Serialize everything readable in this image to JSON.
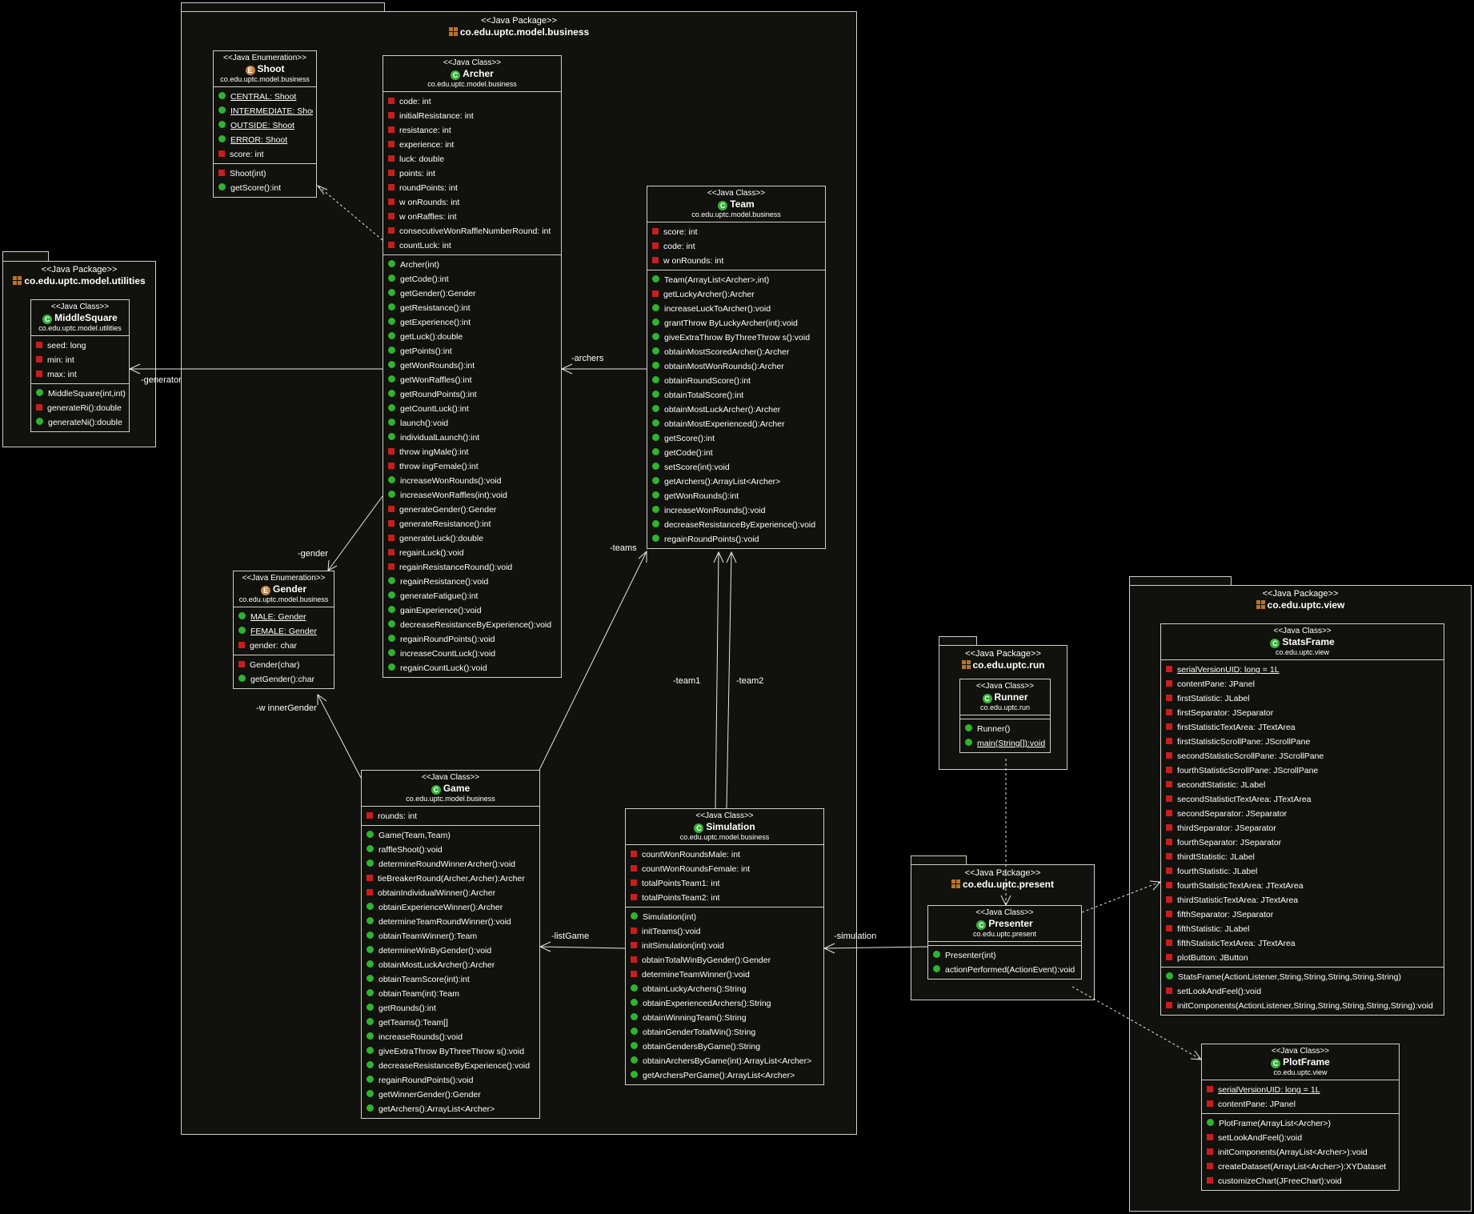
{
  "packages": {
    "business": {
      "stereotype": "<<Java Package>>",
      "name": "co.edu.uptc.model.business"
    },
    "utilities": {
      "stereotype": "<<Java Package>>",
      "name": "co.edu.uptc.model.utilities"
    },
    "view": {
      "stereotype": "<<Java Package>>",
      "name": "co.edu.uptc.view"
    },
    "run": {
      "stereotype": "<<Java Package>>",
      "name": "co.edu.uptc.run"
    },
    "present": {
      "stereotype": "<<Java Package>>",
      "name": "co.edu.uptc.present"
    }
  },
  "classes": {
    "shoot": {
      "stereotype": "<<Java Enumeration>>",
      "name": "Shoot",
      "package": "co.edu.uptc.model.business",
      "attributes": [
        "CENTRAL: Shoot",
        "INTERMEDIATE: Shoot",
        "OUTSIDE: Shoot",
        "ERROR: Shoot",
        "score: int"
      ],
      "operations": [
        "Shoot(int)",
        "getScore():int"
      ]
    },
    "archer": {
      "stereotype": "<<Java Class>>",
      "name": "Archer",
      "package": "co.edu.uptc.model.business",
      "attributes": [
        "code: int",
        "initialResistance: int",
        "resistance: int",
        "experience: int",
        "luck: double",
        "points: int",
        "roundPoints: int",
        "w onRounds: int",
        "w onRaffles: int",
        "consecutiveWonRaffleNumberRound: int",
        "countLuck: int"
      ],
      "operations": [
        "Archer(int)",
        "getCode():int",
        "getGender():Gender",
        "getResistance():int",
        "getExperience():int",
        "getLuck():double",
        "getPoints():int",
        "getWonRounds():int",
        "getWonRaffles():int",
        "getRoundPoints():int",
        "getCountLuck():int",
        "launch():void",
        "individualLaunch():int",
        "throw ingMale():int",
        "throw ingFemale():int",
        "increaseWonRounds():void",
        "increaseWonRaffles(int):void",
        "generateGender():Gender",
        "generateResistance():int",
        "generateLuck():double",
        "regainLuck():void",
        "regainResistanceRound():void",
        "regainResistance():void",
        "generateFatigue():int",
        "gainExperience():void",
        "decreaseResistanceByExperience():void",
        "regainRoundPoints():void",
        "increaseCountLuck():void",
        "regainCountLuck():void"
      ]
    },
    "team": {
      "stereotype": "<<Java Class>>",
      "name": "Team",
      "package": "co.edu.uptc.model.business",
      "attributes": [
        "score: int",
        "code: int",
        "w onRounds: int"
      ],
      "operations": [
        "Team(ArrayList<Archer>,int)",
        "getLuckyArcher():Archer",
        "increaseLuckToArcher():void",
        "grantThrow ByLuckyArcher(int):void",
        "giveExtraThrow ByThreeThrow s():void",
        "obtainMostScoredArcher():Archer",
        "obtainMostWonRounds():Archer",
        "obtainRoundScore():int",
        "obtainTotalScore():int",
        "obtainMostLuckArcher():Archer",
        "obtainMostExperienced():Archer",
        "getScore():int",
        "getCode():int",
        "setScore(int):void",
        "getArchers():ArrayList<Archer>",
        "getWonRounds():int",
        "increaseWonRounds():void",
        "decreaseResistanceByExperience():void",
        "regainRoundPoints():void"
      ]
    },
    "middlesquare": {
      "stereotype": "<<Java Class>>",
      "name": "MiddleSquare",
      "package": "co.edu.uptc.model.utilities",
      "attributes": [
        "seed: long",
        "min: int",
        "max: int"
      ],
      "operations": [
        "MiddleSquare(int,int)",
        "generateRi():double",
        "generateNi():double"
      ]
    },
    "gender": {
      "stereotype": "<<Java Enumeration>>",
      "name": "Gender",
      "package": "co.edu.uptc.model.business",
      "attributes": [
        "MALE: Gender",
        "FEMALE: Gender",
        "gender: char"
      ],
      "operations": [
        "Gender(char)",
        "getGender():char"
      ]
    },
    "game": {
      "stereotype": "<<Java Class>>",
      "name": "Game",
      "package": "co.edu.uptc.model.business",
      "attributes": [
        "rounds: int"
      ],
      "operations": [
        "Game(Team,Team)",
        "raffleShoot():void",
        "determineRoundWinnerArcher():void",
        "tieBreakerRound(Archer,Archer):Archer",
        "obtainIndividualWinner():Archer",
        "obtainExperienceWinner():Archer",
        "determineTeamRoundWinner():void",
        "obtainTeamWinner():Team",
        "determineWinByGender():void",
        "obtainMostLuckArcher():Archer",
        "obtainTeamScore(int):int",
        "obtainTeam(int):Team",
        "getRounds():int",
        "getTeams():Team[]",
        "increaseRounds():void",
        "giveExtraThrow ByThreeThrow s():void",
        "decreaseResistanceByExperience():void",
        "regainRoundPoints():void",
        "getWinnerGender():Gender",
        "getArchers():ArrayList<Archer>"
      ]
    },
    "simulation": {
      "stereotype": "<<Java Class>>",
      "name": "Simulation",
      "package": "co.edu.uptc.model.business",
      "attributes": [
        "countWonRoundsMale: int",
        "countWonRoundsFemale: int",
        "totalPointsTeam1: int",
        "totalPointsTeam2: int"
      ],
      "operations": [
        "Simulation(int)",
        "initTeams():void",
        "initSimulation(int):void",
        "obtainTotalWinByGender():Gender",
        "determineTeamWinner():void",
        "obtainLuckyArchers():String",
        "obtainExperiencedArchers():String",
        "obtainWinningTeam():String",
        "obtainGenderTotalWin():String",
        "obtainGendersByGame():String",
        "obtainArchersByGame(int):ArrayList<Archer>",
        "getArchersPerGame():ArrayList<Archer>"
      ]
    },
    "runner": {
      "stereotype": "<<Java Class>>",
      "name": "Runner",
      "package": "co.edu.uptc.run",
      "attributes": [],
      "operations": [
        "Runner()",
        "main(String[]):void"
      ]
    },
    "presenter": {
      "stereotype": "<<Java Class>>",
      "name": "Presenter",
      "package": "co.edu.uptc.present",
      "attributes": [],
      "operations": [
        "Presenter(int)",
        "actionPerformed(ActionEvent):void"
      ]
    },
    "statsframe": {
      "stereotype": "<<Java Class>>",
      "name": "StatsFrame",
      "package": "co.edu.uptc.view",
      "attributes": [
        "serialVersionUID: long = 1L",
        "contentPane: JPanel",
        "firstStatistic: JLabel",
        "firstSeparator: JSeparator",
        "firstStatisticTextArea: JTextArea",
        "firstStatisticScrollPane: JScrollPane",
        "secondStatisticScrollPane: JScrollPane",
        "fourthStatisticScrollPane: JScrollPane",
        "secondtStatistic: JLabel",
        "secondStatistictTextArea: JTextArea",
        "secondSeparator: JSeparator",
        "thirdSeparator: JSeparator",
        "fourthSeparator: JSeparator",
        "thirdtStatistic: JLabel",
        "fourthStatistic: JLabel",
        "fourthStatisticTextArea: JTextArea",
        "thirdStatisticTextArea: JTextArea",
        "fifthSeparator: JSeparator",
        "fifthStatistic: JLabel",
        "fifthStatisticTextArea: JTextArea",
        "plotButton: JButton"
      ],
      "operations": [
        "StatsFrame(ActionListener,String,String,String,String,String)",
        "setLookAndFeel():void",
        "initComponents(ActionListener,String,String,String,String,String):void"
      ]
    },
    "plotframe": {
      "stereotype": "<<Java Class>>",
      "name": "PlotFrame",
      "package": "co.edu.uptc.view",
      "attributes": [
        "serialVersionUID: long = 1L",
        "contentPane: JPanel"
      ],
      "operations": [
        "PlotFrame(ArrayList<Archer>)",
        "setLookAndFeel():void",
        "initComponents(ArrayList<Archer>):void",
        "createDataset(ArrayList<Archer>):XYDataset",
        "customizeChart(JFreeChart):void"
      ]
    }
  },
  "edges": {
    "generator": "-generator",
    "archers": "-archers",
    "gender": "-gender",
    "teams": "-teams",
    "team1": "-team1",
    "team2": "-team2",
    "winnerGender": "-w innerGender",
    "listGame": "-listGame",
    "simulation": "-simulation"
  }
}
